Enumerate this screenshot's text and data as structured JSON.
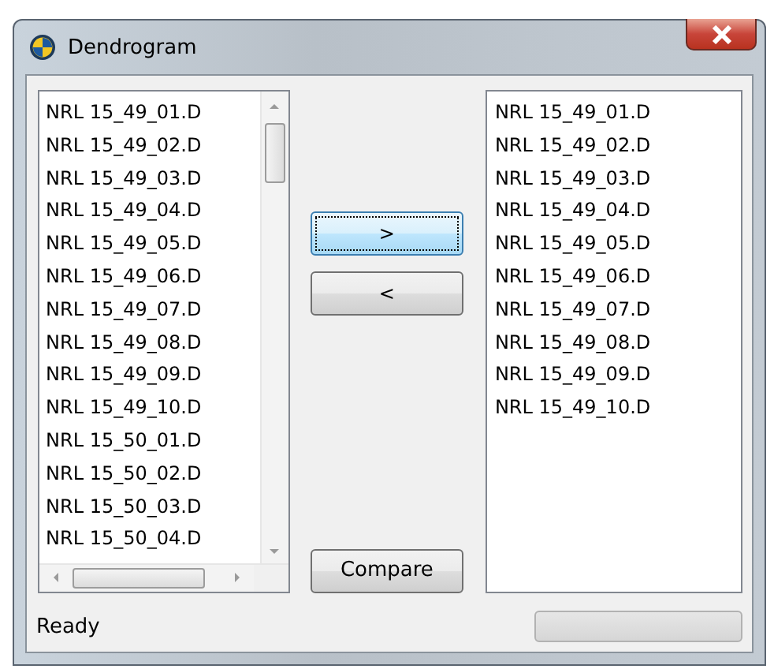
{
  "window": {
    "title": "Dendrogram"
  },
  "left_list": {
    "items": [
      "NRL 15_49_01.D",
      "NRL 15_49_02.D",
      "NRL 15_49_03.D",
      "NRL 15_49_04.D",
      "NRL 15_49_05.D",
      "NRL 15_49_06.D",
      "NRL 15_49_07.D",
      "NRL 15_49_08.D",
      "NRL 15_49_09.D",
      "NRL 15_49_10.D",
      "NRL 15_50_01.D",
      "NRL 15_50_02.D",
      "NRL 15_50_03.D",
      "NRL 15_50_04.D"
    ]
  },
  "buttons": [
    {
      "label": ">",
      "focused": true
    },
    {
      "label": "<",
      "focused": false
    }
  ],
  "compare_button": {
    "label": "Compare"
  },
  "right_list": {
    "items": [
      "NRL 15_49_01.D",
      "NRL 15_49_02.D",
      "NRL 15_49_03.D",
      "NRL 15_49_04.D",
      "NRL 15_49_05.D",
      "NRL 15_49_06.D",
      "NRL 15_49_07.D",
      "NRL 15_49_08.D",
      "NRL 15_49_09.D",
      "NRL 15_49_10.D"
    ]
  },
  "status_bar": {
    "text": "Ready",
    "progress": {
      "level": 0
    }
  }
}
